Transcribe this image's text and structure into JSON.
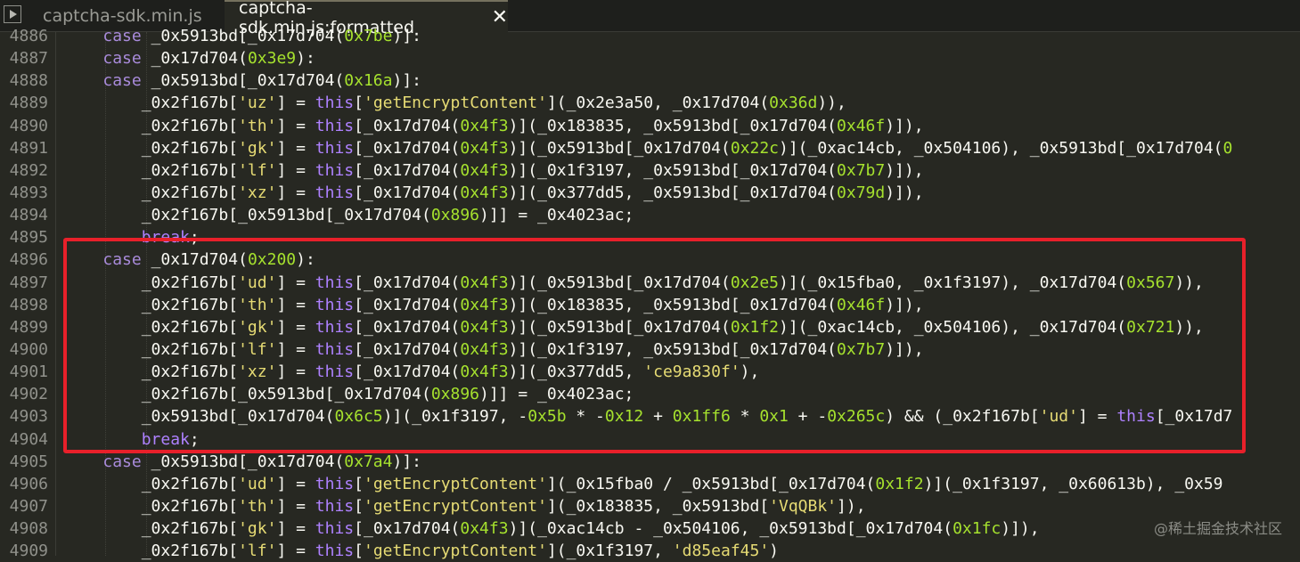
{
  "tabs": [
    {
      "label": "captcha-sdk.min.js"
    },
    {
      "label": "captcha-sdk.min.js:formatted"
    }
  ],
  "close_glyph": "✕",
  "watermark": "@稀土掘金技术社区",
  "colors": {
    "highlight_border": "#e8202a",
    "editor_bg": "#272822"
  },
  "lines": [
    {
      "num": "4886",
      "tokens": [
        [
          "    ",
          ""
        ],
        [
          "case",
          "case"
        ],
        [
          " _0x5913bd[_0x17d704(",
          ""
        ],
        [
          "0x7be",
          "hex"
        ],
        [
          ")]:",
          ""
        ]
      ]
    },
    {
      "num": "4887",
      "tokens": [
        [
          "    ",
          ""
        ],
        [
          "case",
          "case"
        ],
        [
          " _0x17d704(",
          ""
        ],
        [
          "0x3e9",
          "hex"
        ],
        [
          "):",
          ""
        ]
      ]
    },
    {
      "num": "4888",
      "tokens": [
        [
          "    ",
          ""
        ],
        [
          "case",
          "case"
        ],
        [
          " _0x5913bd[_0x17d704(",
          ""
        ],
        [
          "0x16a",
          "hex"
        ],
        [
          ")]:",
          ""
        ]
      ]
    },
    {
      "num": "4889",
      "tokens": [
        [
          "        _0x2f167b[",
          ""
        ],
        [
          "'uz'",
          "str"
        ],
        [
          "] = ",
          ""
        ],
        [
          "this",
          "this"
        ],
        [
          "[",
          ""
        ],
        [
          "'getEncryptContent'",
          "str"
        ],
        [
          "](_0x2e3a50, _0x17d704(",
          ""
        ],
        [
          "0x36d",
          "hex"
        ],
        [
          ")),",
          ""
        ]
      ]
    },
    {
      "num": "4890",
      "tokens": [
        [
          "        _0x2f167b[",
          ""
        ],
        [
          "'th'",
          "str"
        ],
        [
          "] = ",
          ""
        ],
        [
          "this",
          "this"
        ],
        [
          "[_0x17d704(",
          ""
        ],
        [
          "0x4f3",
          "hex"
        ],
        [
          ")](_0x183835, _0x5913bd[_0x17d704(",
          ""
        ],
        [
          "0x46f",
          "hex"
        ],
        [
          ")]),",
          ""
        ]
      ]
    },
    {
      "num": "4891",
      "tokens": [
        [
          "        _0x2f167b[",
          ""
        ],
        [
          "'gk'",
          "str"
        ],
        [
          "] = ",
          ""
        ],
        [
          "this",
          "this"
        ],
        [
          "[_0x17d704(",
          ""
        ],
        [
          "0x4f3",
          "hex"
        ],
        [
          ")](_0x5913bd[_0x17d704(",
          ""
        ],
        [
          "0x22c",
          "hex"
        ],
        [
          ")](_0xac14cb, _0x504106), _0x5913bd[_0x17d704(",
          ""
        ],
        [
          "0",
          "hex"
        ]
      ]
    },
    {
      "num": "4892",
      "tokens": [
        [
          "        _0x2f167b[",
          ""
        ],
        [
          "'lf'",
          "str"
        ],
        [
          "] = ",
          ""
        ],
        [
          "this",
          "this"
        ],
        [
          "[_0x17d704(",
          ""
        ],
        [
          "0x4f3",
          "hex"
        ],
        [
          ")](_0x1f3197, _0x5913bd[_0x17d704(",
          ""
        ],
        [
          "0x7b7",
          "hex"
        ],
        [
          ")]),",
          ""
        ]
      ]
    },
    {
      "num": "4893",
      "tokens": [
        [
          "        _0x2f167b[",
          ""
        ],
        [
          "'xz'",
          "str"
        ],
        [
          "] = ",
          ""
        ],
        [
          "this",
          "this"
        ],
        [
          "[_0x17d704(",
          ""
        ],
        [
          "0x4f3",
          "hex"
        ],
        [
          ")](_0x377dd5, _0x5913bd[_0x17d704(",
          ""
        ],
        [
          "0x79d",
          "hex"
        ],
        [
          ")]),",
          ""
        ]
      ]
    },
    {
      "num": "4894",
      "tokens": [
        [
          "        _0x2f167b[_0x5913bd[_0x17d704(",
          ""
        ],
        [
          "0x896",
          "hex"
        ],
        [
          ")]] = _0x4023ac;",
          ""
        ]
      ]
    },
    {
      "num": "4895",
      "tokens": [
        [
          "        ",
          ""
        ],
        [
          "break",
          "brk"
        ],
        [
          ";",
          ""
        ]
      ]
    },
    {
      "num": "4896",
      "tokens": [
        [
          "    ",
          ""
        ],
        [
          "case",
          "case"
        ],
        [
          " _0x17d704(",
          ""
        ],
        [
          "0x200",
          "hex"
        ],
        [
          "):",
          ""
        ]
      ]
    },
    {
      "num": "4897",
      "tokens": [
        [
          "        _0x2f167b[",
          ""
        ],
        [
          "'ud'",
          "str"
        ],
        [
          "] = ",
          ""
        ],
        [
          "this",
          "this"
        ],
        [
          "[_0x17d704(",
          ""
        ],
        [
          "0x4f3",
          "hex"
        ],
        [
          ")](_0x5913bd[_0x17d704(",
          ""
        ],
        [
          "0x2e5",
          "hex"
        ],
        [
          ")](_0x15fba0, _0x1f3197), _0x17d704(",
          ""
        ],
        [
          "0x567",
          "hex"
        ],
        [
          ")),",
          ""
        ]
      ]
    },
    {
      "num": "4898",
      "tokens": [
        [
          "        _0x2f167b[",
          ""
        ],
        [
          "'th'",
          "str"
        ],
        [
          "] = ",
          ""
        ],
        [
          "this",
          "this"
        ],
        [
          "[_0x17d704(",
          ""
        ],
        [
          "0x4f3",
          "hex"
        ],
        [
          ")](_0x183835, _0x5913bd[_0x17d704(",
          ""
        ],
        [
          "0x46f",
          "hex"
        ],
        [
          ")]),",
          ""
        ]
      ]
    },
    {
      "num": "4899",
      "tokens": [
        [
          "        _0x2f167b[",
          ""
        ],
        [
          "'gk'",
          "str"
        ],
        [
          "] = ",
          ""
        ],
        [
          "this",
          "this"
        ],
        [
          "[_0x17d704(",
          ""
        ],
        [
          "0x4f3",
          "hex"
        ],
        [
          ")](_0x5913bd[_0x17d704(",
          ""
        ],
        [
          "0x1f2",
          "hex"
        ],
        [
          ")](_0xac14cb, _0x504106), _0x17d704(",
          ""
        ],
        [
          "0x721",
          "hex"
        ],
        [
          ")),",
          ""
        ]
      ]
    },
    {
      "num": "4900",
      "tokens": [
        [
          "        _0x2f167b[",
          ""
        ],
        [
          "'lf'",
          "str"
        ],
        [
          "] = ",
          ""
        ],
        [
          "this",
          "this"
        ],
        [
          "[_0x17d704(",
          ""
        ],
        [
          "0x4f3",
          "hex"
        ],
        [
          ")](_0x1f3197, _0x5913bd[_0x17d704(",
          ""
        ],
        [
          "0x7b7",
          "hex"
        ],
        [
          ")]),",
          ""
        ]
      ]
    },
    {
      "num": "4901",
      "tokens": [
        [
          "        _0x2f167b[",
          ""
        ],
        [
          "'xz'",
          "str"
        ],
        [
          "] = ",
          ""
        ],
        [
          "this",
          "this"
        ],
        [
          "[_0x17d704(",
          ""
        ],
        [
          "0x4f3",
          "hex"
        ],
        [
          ")](_0x377dd5, ",
          ""
        ],
        [
          "'ce9a830f'",
          "str"
        ],
        [
          "),",
          ""
        ]
      ]
    },
    {
      "num": "4902",
      "tokens": [
        [
          "        _0x2f167b[_0x5913bd[_0x17d704(",
          ""
        ],
        [
          "0x896",
          "hex"
        ],
        [
          ")]] = _0x4023ac;",
          ""
        ]
      ]
    },
    {
      "num": "4903",
      "tokens": [
        [
          "        _0x5913bd[_0x17d704(",
          ""
        ],
        [
          "0x6c5",
          "hex"
        ],
        [
          ")](_0x1f3197, -",
          ""
        ],
        [
          "0x5b",
          "hex"
        ],
        [
          " * -",
          ""
        ],
        [
          "0x12",
          "hex"
        ],
        [
          " + ",
          ""
        ],
        [
          "0x1ff6",
          "hex"
        ],
        [
          " * ",
          ""
        ],
        [
          "0x1",
          "hex"
        ],
        [
          " + -",
          ""
        ],
        [
          "0x265c",
          "hex"
        ],
        [
          ") && (_0x2f167b[",
          ""
        ],
        [
          "'ud'",
          "str"
        ],
        [
          "] = ",
          ""
        ],
        [
          "this",
          "this"
        ],
        [
          "[_0x17d7",
          ""
        ]
      ]
    },
    {
      "num": "4904",
      "tokens": [
        [
          "        ",
          ""
        ],
        [
          "break",
          "brk"
        ],
        [
          ";",
          ""
        ]
      ]
    },
    {
      "num": "4905",
      "tokens": [
        [
          "    ",
          ""
        ],
        [
          "case",
          "case"
        ],
        [
          " _0x5913bd[_0x17d704(",
          ""
        ],
        [
          "0x7a4",
          "hex"
        ],
        [
          ")]:",
          ""
        ]
      ]
    },
    {
      "num": "4906",
      "tokens": [
        [
          "        _0x2f167b[",
          ""
        ],
        [
          "'ud'",
          "str"
        ],
        [
          "] = ",
          ""
        ],
        [
          "this",
          "this"
        ],
        [
          "[",
          ""
        ],
        [
          "'getEncryptContent'",
          "str"
        ],
        [
          "](_0x15fba0 / _0x5913bd[_0x17d704(",
          ""
        ],
        [
          "0x1f2",
          "hex"
        ],
        [
          ")](_0x1f3197, _0x60613b), _0x59",
          ""
        ]
      ]
    },
    {
      "num": "4907",
      "tokens": [
        [
          "        _0x2f167b[",
          ""
        ],
        [
          "'th'",
          "str"
        ],
        [
          "] = ",
          ""
        ],
        [
          "this",
          "this"
        ],
        [
          "[",
          ""
        ],
        [
          "'getEncryptContent'",
          "str"
        ],
        [
          "](_0x183835, _0x5913bd[",
          ""
        ],
        [
          "'VqQBk'",
          "str"
        ],
        [
          "]),",
          ""
        ]
      ]
    },
    {
      "num": "4908",
      "tokens": [
        [
          "        _0x2f167b[",
          ""
        ],
        [
          "'gk'",
          "str"
        ],
        [
          "] = ",
          ""
        ],
        [
          "this",
          "this"
        ],
        [
          "[_0x17d704(",
          ""
        ],
        [
          "0x4f3",
          "hex"
        ],
        [
          ")](_0xac14cb - _0x504106, _0x5913bd[_0x17d704(",
          ""
        ],
        [
          "0x1fc",
          "hex"
        ],
        [
          ")]),",
          ""
        ]
      ]
    },
    {
      "num": "4909",
      "tokens": [
        [
          "        _0x2f167b[",
          ""
        ],
        [
          "'lf'",
          "str"
        ],
        [
          "] = ",
          ""
        ],
        [
          "this",
          "this"
        ],
        [
          "[",
          ""
        ],
        [
          "'getEncryptContent'",
          "str"
        ],
        [
          "](_0x1f3197, ",
          ""
        ],
        [
          "'d85eaf45'",
          "str"
        ],
        [
          ")",
          ""
        ]
      ]
    }
  ]
}
